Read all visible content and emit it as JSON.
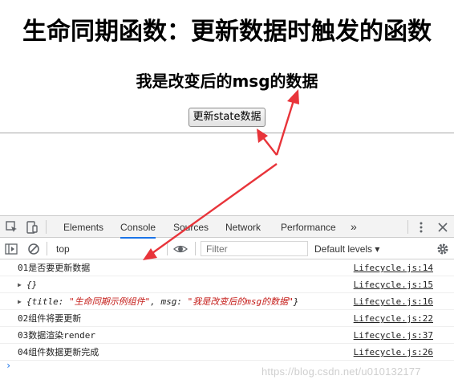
{
  "page": {
    "heading": "生命同期函数：更新数据时触发的函数",
    "message": "我是改变后的msg的数据",
    "update_button_label": "更新state数据"
  },
  "devtools": {
    "tabs": [
      "Elements",
      "Console",
      "Sources",
      "Network",
      "Performance"
    ],
    "active_tab": "Console",
    "more_label": "»",
    "context": "top",
    "filter_placeholder": "Filter",
    "levels_label": "Default levels ▾",
    "accent_color": "#1a73e8",
    "string_color": "#c41a16"
  },
  "console": {
    "rows": [
      {
        "text": "01是否要更新数据",
        "source": "Lifecycle.js:14"
      },
      {
        "text": "{}",
        "source": "Lifecycle.js:15"
      },
      {
        "prefix": "{title: ",
        "title_value": "\"生命同期示例组件\"",
        "mid": ", msg: ",
        "msg_value": "\"我是改变后的msg的数据\"",
        "suffix": "}",
        "source": "Lifecycle.js:16"
      },
      {
        "text": "02组件将要更新",
        "source": "Lifecycle.js:22"
      },
      {
        "text": "03数据渲染render",
        "source": "Lifecycle.js:37"
      },
      {
        "text": "04组件数据更新完成",
        "source": "Lifecycle.js:26"
      }
    ],
    "prompt_symbol": "›"
  },
  "watermark": "https://blog.csdn.net/u010132177",
  "annotation_color": "#e8343a"
}
